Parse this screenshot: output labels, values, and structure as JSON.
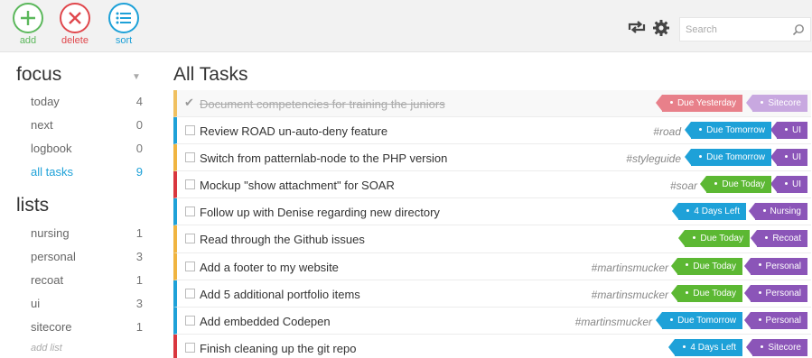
{
  "toolbar": {
    "add_label": "add",
    "delete_label": "delete",
    "sort_label": "sort",
    "search_placeholder": "Search",
    "icons": {
      "sync": "sync-icon",
      "settings": "gear-icon",
      "search": "search-icon"
    }
  },
  "sidebar": {
    "focus_title": "focus",
    "focus_items": [
      {
        "label": "today",
        "count": "4"
      },
      {
        "label": "next",
        "count": "0"
      },
      {
        "label": "logbook",
        "count": "0"
      },
      {
        "label": "all tasks",
        "count": "9",
        "active": true
      }
    ],
    "lists_title": "lists",
    "list_items": [
      {
        "label": "nursing",
        "count": "1"
      },
      {
        "label": "personal",
        "count": "3"
      },
      {
        "label": "recoat",
        "count": "1"
      },
      {
        "label": "ui",
        "count": "3"
      },
      {
        "label": "sitecore",
        "count": "1"
      }
    ],
    "add_list_label": "add list"
  },
  "main": {
    "title": "All Tasks",
    "tasks": [
      {
        "title": "Document competencies for training the juniors",
        "done": true,
        "tag": "",
        "due": "Due Yesterday",
        "list": "Sitecore",
        "bar": "#f0c060",
        "due_color": "#e8808a",
        "list_color": "#c8a8e0"
      },
      {
        "title": "Review ROAD un-auto-deny feature",
        "done": false,
        "tag": "#road",
        "due": "Due Tomorrow",
        "list": "UI",
        "bar": "#1ea1d8",
        "due_color": "#1ea1d8",
        "list_color": "#8b55b8"
      },
      {
        "title": "Switch from patternlab-node to the PHP version",
        "done": false,
        "tag": "#styleguide",
        "due": "Due Tomorrow",
        "list": "UI",
        "bar": "#f0b440",
        "due_color": "#1ea1d8",
        "list_color": "#8b55b8"
      },
      {
        "title": "Mockup \"show attachment\" for SOAR",
        "done": false,
        "tag": "#soar",
        "due": "Due Today",
        "list": "UI",
        "bar": "#d9363e",
        "due_color": "#5cb833",
        "list_color": "#8b55b8"
      },
      {
        "title": "Follow up with Denise regarding new directory",
        "done": false,
        "tag": "",
        "due": "4 Days Left",
        "list": "Nursing",
        "bar": "#1ea1d8",
        "due_color": "#1ea1d8",
        "list_color": "#8b55b8"
      },
      {
        "title": "Read through the Github issues",
        "done": false,
        "tag": "",
        "due": "Due Today",
        "list": "Recoat",
        "bar": "#f0b440",
        "due_color": "#5cb833",
        "list_color": "#8b55b8"
      },
      {
        "title": "Add a footer to my website",
        "done": false,
        "tag": "#martinsmucker",
        "due": "Due Today",
        "list": "Personal",
        "bar": "#f0b440",
        "due_color": "#5cb833",
        "list_color": "#8b55b8"
      },
      {
        "title": "Add 5 additional portfolio items",
        "done": false,
        "tag": "#martinsmucker",
        "due": "Due Today",
        "list": "Personal",
        "bar": "#1ea1d8",
        "due_color": "#5cb833",
        "list_color": "#8b55b8"
      },
      {
        "title": "Add embedded Codepen",
        "done": false,
        "tag": "#martinsmucker",
        "due": "Due Tomorrow",
        "list": "Personal",
        "bar": "#1ea1d8",
        "due_color": "#1ea1d8",
        "list_color": "#8b55b8"
      },
      {
        "title": "Finish cleaning up the git repo",
        "done": false,
        "tag": "",
        "due": "4 Days Left",
        "list": "Sitecore",
        "bar": "#d9363e",
        "due_color": "#1ea1d8",
        "list_color": "#8b55b8"
      }
    ]
  },
  "colors": {
    "green": "#5cb85c",
    "red": "#e0474c",
    "blue": "#1ea1d8",
    "purple": "#8b55b8"
  }
}
